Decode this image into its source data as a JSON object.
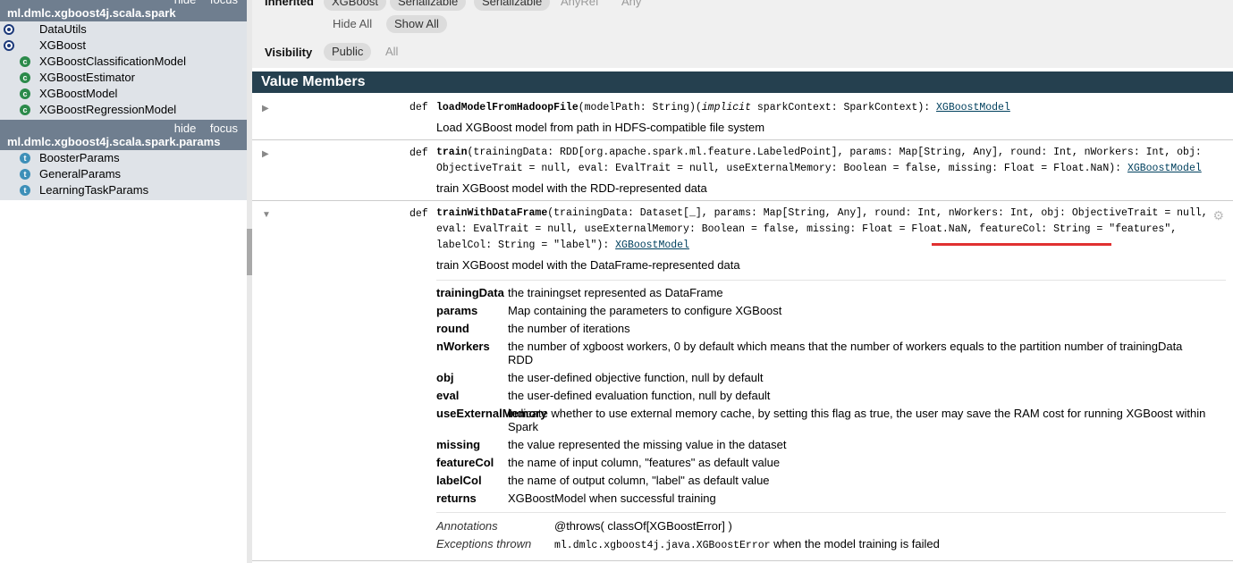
{
  "sidebar": {
    "links": {
      "hide": "hide",
      "focus": "focus"
    },
    "packages": [
      {
        "name": "ml.dmlc.xgboost4j.scala.spark",
        "items": [
          {
            "kind": "object",
            "label": "DataUtils"
          },
          {
            "kind": "object",
            "label": "XGBoost"
          },
          {
            "kind": "class",
            "label": "XGBoostClassificationModel"
          },
          {
            "kind": "class",
            "label": "XGBoostEstimator"
          },
          {
            "kind": "class",
            "label": "XGBoostModel"
          },
          {
            "kind": "class",
            "label": "XGBoostRegressionModel"
          }
        ]
      },
      {
        "name": "ml.dmlc.xgboost4j.scala.spark.params",
        "items": [
          {
            "kind": "trait",
            "label": "BoosterParams"
          },
          {
            "kind": "trait",
            "label": "GeneralParams"
          },
          {
            "kind": "trait",
            "label": "LearningTaskParams"
          }
        ]
      }
    ]
  },
  "filters": {
    "inherited_label": "Inherited",
    "inherited_pills": [
      "XGBoost",
      "Serializable",
      "Serializable",
      "AnyRef",
      "Any"
    ],
    "hide_all": "Hide All",
    "show_all": "Show All",
    "visibility_label": "Visibility",
    "public": "Public",
    "all": "All"
  },
  "value_members_title": "Value Members",
  "members": [
    {
      "kw": "def",
      "name": "loadModelFromHadoopFile",
      "sig_a": "(modelPath: String)(",
      "sig_implicit": "implicit",
      "sig_b": " sparkContext: SparkContext): ",
      "ret": "XGBoostModel",
      "desc": "Load XGBoost model from path in HDFS-compatible file system"
    },
    {
      "kw": "def",
      "name": "train",
      "sig_a": "(trainingData: RDD[org.apache.spark.ml.feature.LabeledPoint], params: Map[String, Any], round: Int, nWorkers: Int, obj: ObjectiveTrait = null, eval: EvalTrait = null, useExternalMemory: Boolean = false, missing: Float = Float.NaN): ",
      "ret": "XGBoostModel",
      "desc": "train XGBoost model with the RDD-represented data"
    },
    {
      "kw": "def",
      "name": "trainWithDataFrame",
      "sig_a": "(trainingData: Dataset[_], params: Map[String, Any], round: Int, nWorkers: Int, obj: ObjectiveTrait = null, eval: EvalTrait = null, useExternalMemory: Boolean = false, missing: Float = Float.NaN, featureCol: String = \"features\", labelCol: String = \"label\"): ",
      "ret": "XGBoostModel",
      "desc": "train XGBoost model with the DataFrame-represented data",
      "params": [
        {
          "name": "trainingData",
          "desc": "the trainingset represented as DataFrame"
        },
        {
          "name": "params",
          "desc": "Map containing the parameters to configure XGBoost"
        },
        {
          "name": "round",
          "desc": "the number of iterations"
        },
        {
          "name": "nWorkers",
          "desc": "the number of xgboost workers, 0 by default which means that the number of workers equals to the partition number of trainingData RDD"
        },
        {
          "name": "obj",
          "desc": "the user-defined objective function, null by default"
        },
        {
          "name": "eval",
          "desc": "the user-defined evaluation function, null by default"
        },
        {
          "name": "useExternalMemory",
          "desc": "indicate whether to use external memory cache, by setting this flag as true, the user may save the RAM cost for running XGBoost within Spark"
        },
        {
          "name": "missing",
          "desc": "the value represented the missing value in the dataset"
        },
        {
          "name": "featureCol",
          "desc": "the name of input column, \"features\" as default value"
        },
        {
          "name": "labelCol",
          "desc": "the name of output column, \"label\" as default value"
        },
        {
          "name": "returns",
          "desc": "XGBoostModel when successful training"
        }
      ],
      "annotations_label": "Annotations",
      "annotations_value": "@throws( classOf[XGBoostError] )",
      "exceptions_label": "Exceptions thrown",
      "exceptions_code": "ml.dmlc.xgboost4j.java.XGBoostError",
      "exceptions_text": " when the model training is failed"
    }
  ]
}
